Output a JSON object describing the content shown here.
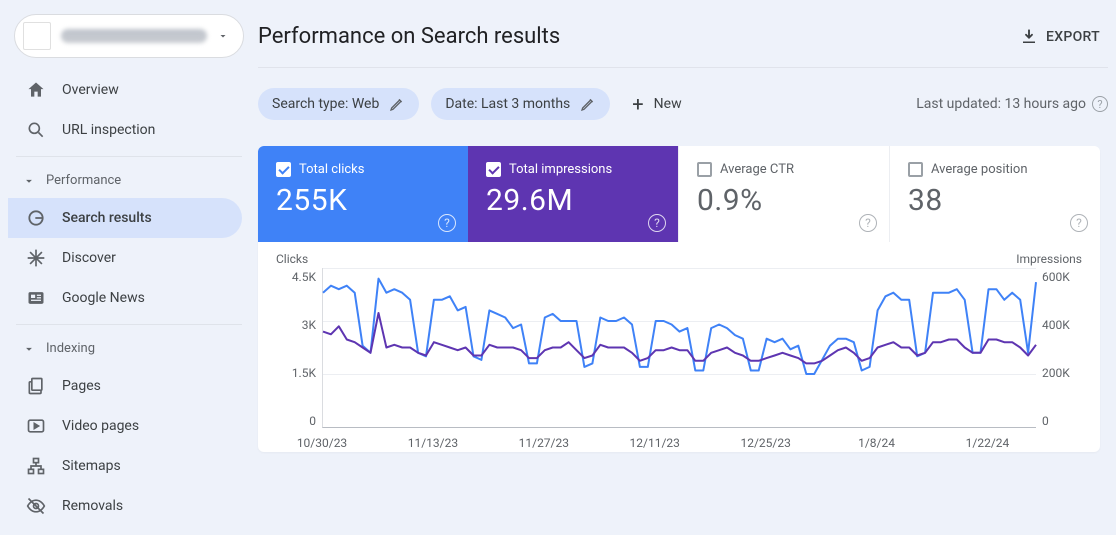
{
  "sidebar": {
    "overview": "Overview",
    "url_inspection": "URL inspection",
    "group_performance": "Performance",
    "search_results": "Search results",
    "discover": "Discover",
    "google_news": "Google News",
    "group_indexing": "Indexing",
    "pages": "Pages",
    "video_pages": "Video pages",
    "sitemaps": "Sitemaps",
    "removals": "Removals"
  },
  "header": {
    "title": "Performance on Search results",
    "export": "EXPORT"
  },
  "filters": {
    "search_type": "Search type: Web",
    "date": "Date: Last 3 months",
    "new": "New",
    "last_updated": "Last updated: 13 hours ago"
  },
  "metrics": {
    "clicks_label": "Total clicks",
    "clicks_value": "255K",
    "impr_label": "Total impressions",
    "impr_value": "29.6M",
    "ctr_label": "Average CTR",
    "ctr_value": "0.9%",
    "pos_label": "Average position",
    "pos_value": "38"
  },
  "chart_axes": {
    "left_title": "Clicks",
    "right_title": "Impressions",
    "left": [
      "4.5K",
      "3K",
      "1.5K",
      "0"
    ],
    "right": [
      "600K",
      "400K",
      "200K",
      "0"
    ],
    "x": [
      "10/30/23",
      "11/13/23",
      "11/27/23",
      "12/11/23",
      "12/25/23",
      "1/8/24",
      "1/22/24"
    ]
  },
  "chart_data": {
    "type": "line",
    "title": "Performance on Search results",
    "x": [
      "10/30/23",
      "10/31/23",
      "11/1/23",
      "11/2/23",
      "11/3/23",
      "11/4/23",
      "11/5/23",
      "11/6/23",
      "11/7/23",
      "11/8/23",
      "11/9/23",
      "11/10/23",
      "11/11/23",
      "11/12/23",
      "11/13/23",
      "11/14/23",
      "11/15/23",
      "11/16/23",
      "11/17/23",
      "11/18/23",
      "11/19/23",
      "11/20/23",
      "11/21/23",
      "11/22/23",
      "11/23/23",
      "11/24/23",
      "11/25/23",
      "11/26/23",
      "11/27/23",
      "11/28/23",
      "11/29/23",
      "11/30/23",
      "12/1/23",
      "12/2/23",
      "12/3/23",
      "12/4/23",
      "12/5/23",
      "12/6/23",
      "12/7/23",
      "12/8/23",
      "12/9/23",
      "12/10/23",
      "12/11/23",
      "12/12/23",
      "12/13/23",
      "12/14/23",
      "12/15/23",
      "12/16/23",
      "12/17/23",
      "12/18/23",
      "12/19/23",
      "12/20/23",
      "12/21/23",
      "12/22/23",
      "12/23/23",
      "12/24/23",
      "12/25/23",
      "12/26/23",
      "12/27/23",
      "12/28/23",
      "12/29/23",
      "12/30/23",
      "12/31/23",
      "1/1/24",
      "1/2/24",
      "1/3/24",
      "1/4/24",
      "1/5/24",
      "1/6/24",
      "1/7/24",
      "1/8/24",
      "1/9/24",
      "1/10/24",
      "1/11/24",
      "1/12/24",
      "1/13/24",
      "1/14/24",
      "1/15/24",
      "1/16/24",
      "1/17/24",
      "1/18/24",
      "1/19/24",
      "1/20/24",
      "1/21/24",
      "1/22/24",
      "1/23/24",
      "1/24/24",
      "1/25/24",
      "1/26/24",
      "1/27/24",
      "1/28/24"
    ],
    "series": [
      {
        "name": "Clicks",
        "axis": "left",
        "color": "#3f82f7",
        "values": [
          3800,
          4000,
          3900,
          4000,
          3800,
          2300,
          2100,
          4200,
          3800,
          3900,
          3800,
          3600,
          2100,
          2000,
          3600,
          3600,
          3700,
          3300,
          3400,
          2000,
          1900,
          3300,
          3200,
          3100,
          2800,
          2900,
          1800,
          1800,
          3100,
          3200,
          3000,
          3000,
          3000,
          1700,
          1800,
          3100,
          3000,
          3000,
          3100,
          2900,
          1700,
          1700,
          3000,
          3000,
          2900,
          2700,
          2800,
          1600,
          1600,
          2800,
          2900,
          2800,
          2600,
          2500,
          1600,
          1600,
          2500,
          2400,
          2500,
          2200,
          2300,
          1500,
          1500,
          1900,
          2300,
          2500,
          2500,
          2400,
          1600,
          1700,
          3300,
          3700,
          3800,
          3600,
          3600,
          2000,
          2100,
          3800,
          3800,
          3800,
          3900,
          3600,
          2100,
          2100,
          3900,
          3900,
          3600,
          3800,
          3600,
          2100,
          4100
        ]
      },
      {
        "name": "Impressions",
        "axis": "right",
        "color": "#5e35b1",
        "values": [
          360000,
          350000,
          380000,
          330000,
          320000,
          300000,
          280000,
          430000,
          300000,
          310000,
          300000,
          300000,
          280000,
          270000,
          320000,
          310000,
          300000,
          290000,
          300000,
          270000,
          270000,
          310000,
          300000,
          300000,
          300000,
          290000,
          260000,
          260000,
          290000,
          300000,
          300000,
          320000,
          290000,
          260000,
          270000,
          310000,
          300000,
          300000,
          300000,
          280000,
          250000,
          260000,
          290000,
          290000,
          300000,
          290000,
          290000,
          250000,
          250000,
          280000,
          290000,
          300000,
          280000,
          270000,
          250000,
          250000,
          260000,
          270000,
          280000,
          270000,
          260000,
          240000,
          240000,
          250000,
          270000,
          290000,
          300000,
          280000,
          250000,
          260000,
          300000,
          310000,
          320000,
          300000,
          300000,
          270000,
          280000,
          320000,
          320000,
          330000,
          330000,
          300000,
          280000,
          280000,
          330000,
          330000,
          320000,
          320000,
          300000,
          270000,
          310000
        ]
      }
    ],
    "y_left": {
      "label": "Clicks",
      "min": 0,
      "max": 4500
    },
    "y_right": {
      "label": "Impressions",
      "min": 0,
      "max": 600000
    },
    "x_ticks_shown": [
      "10/30/23",
      "11/13/23",
      "11/27/23",
      "12/11/23",
      "12/25/23",
      "1/8/24",
      "1/22/24"
    ]
  }
}
